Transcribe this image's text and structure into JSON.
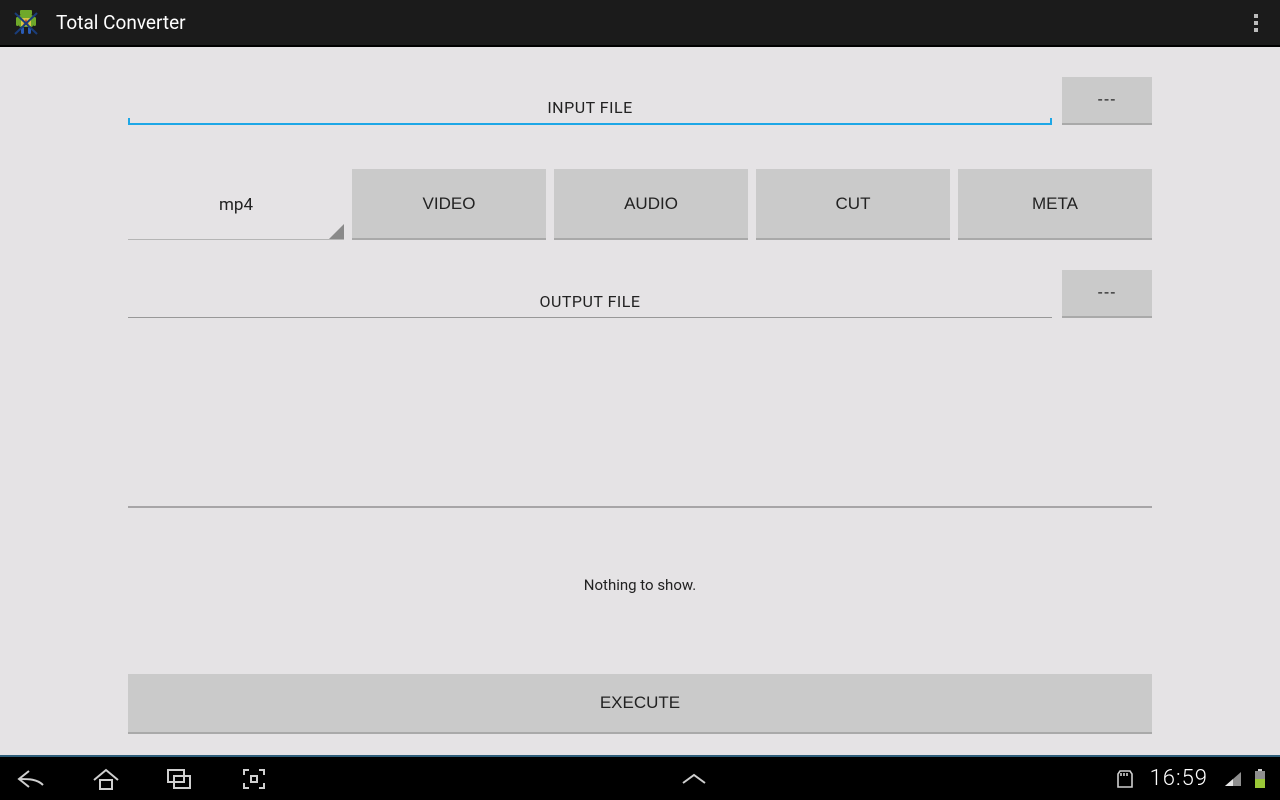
{
  "app": {
    "title": "Total Converter"
  },
  "input": {
    "label": "INPUT FILE",
    "pick": "---"
  },
  "spinner": {
    "value": "mp4"
  },
  "tabs": {
    "video": "VIDEO",
    "audio": "AUDIO",
    "cut": "CUT",
    "meta": "META"
  },
  "output": {
    "label": "OUTPUT FILE",
    "pick": "---"
  },
  "status": "Nothing to show.",
  "execute": "EXECUTE",
  "statusbar": {
    "time": "16:59"
  }
}
